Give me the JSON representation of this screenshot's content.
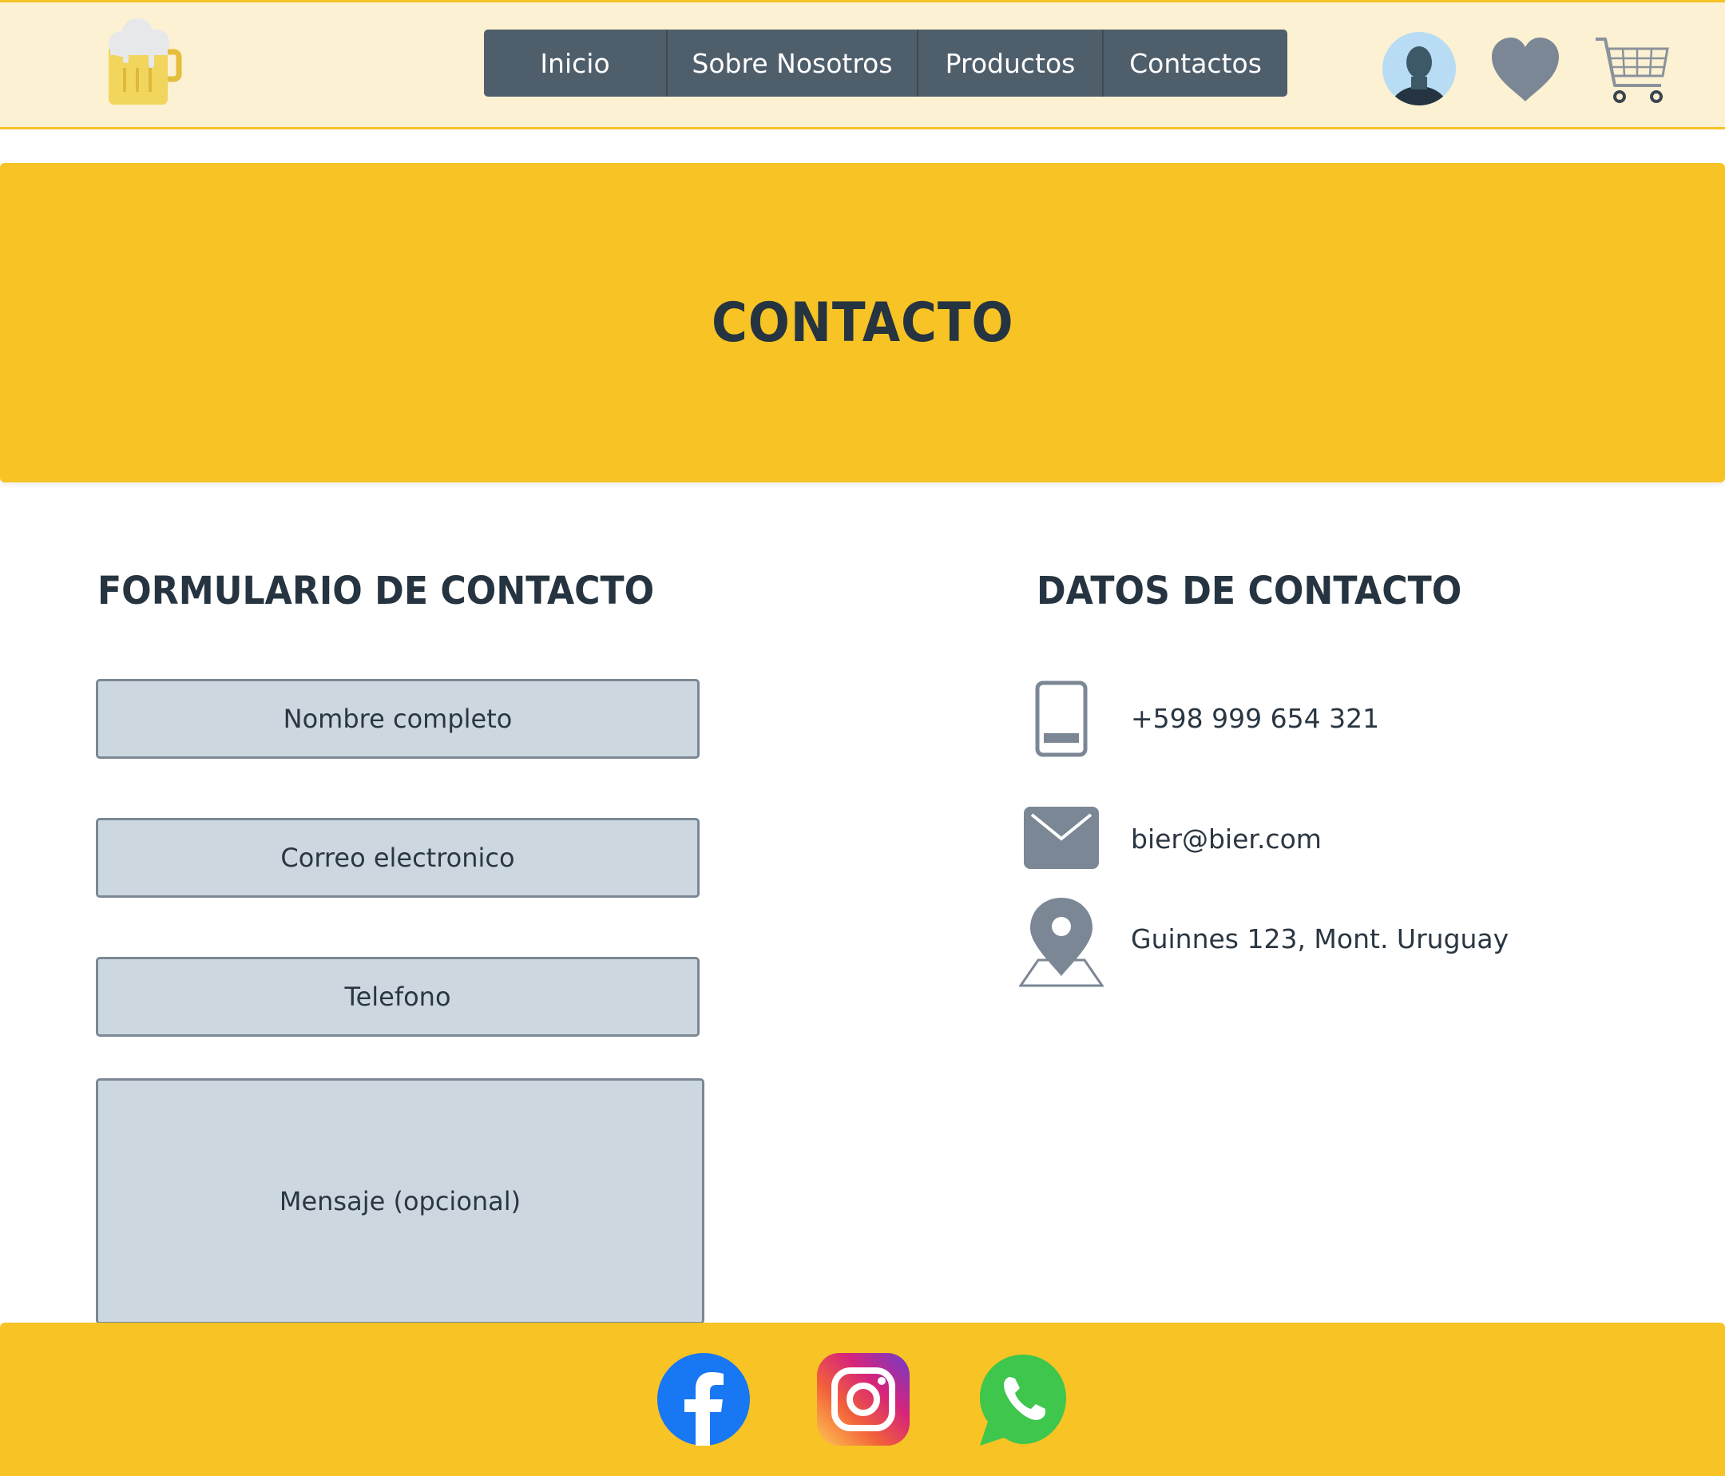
{
  "header": {
    "nav": [
      {
        "label": "Inicio"
      },
      {
        "label": "Sobre Nosotros"
      },
      {
        "label": "Productos"
      },
      {
        "label": "Contactos"
      }
    ],
    "icons": [
      "beer-mug-logo-icon",
      "user-avatar-icon",
      "heart-icon",
      "shopping-cart-icon"
    ]
  },
  "banner": {
    "title": "CONTACTO"
  },
  "form": {
    "title": "FORMULARIO DE CONTACTO",
    "fields": {
      "name": "Nombre completo",
      "email": "Correo electronico",
      "phone": "Telefono",
      "message": "Mensaje (opcional)"
    }
  },
  "info": {
    "title": "DATOS DE CONTACTO",
    "phone": "+598 999 654 321",
    "email": "bier@bier.com",
    "address": "Guinnes 123, Mont. Uruguay"
  },
  "footer": {
    "social": [
      "facebook-icon",
      "instagram-icon",
      "whatsapp-icon"
    ]
  },
  "colors": {
    "accent": "#f7c325",
    "header_bg": "#fdf1d3",
    "nav_bg": "#4f5e6b",
    "field_bg": "#cdd7df",
    "text_dark": "#253440",
    "icon_gray": "#7b8794"
  }
}
